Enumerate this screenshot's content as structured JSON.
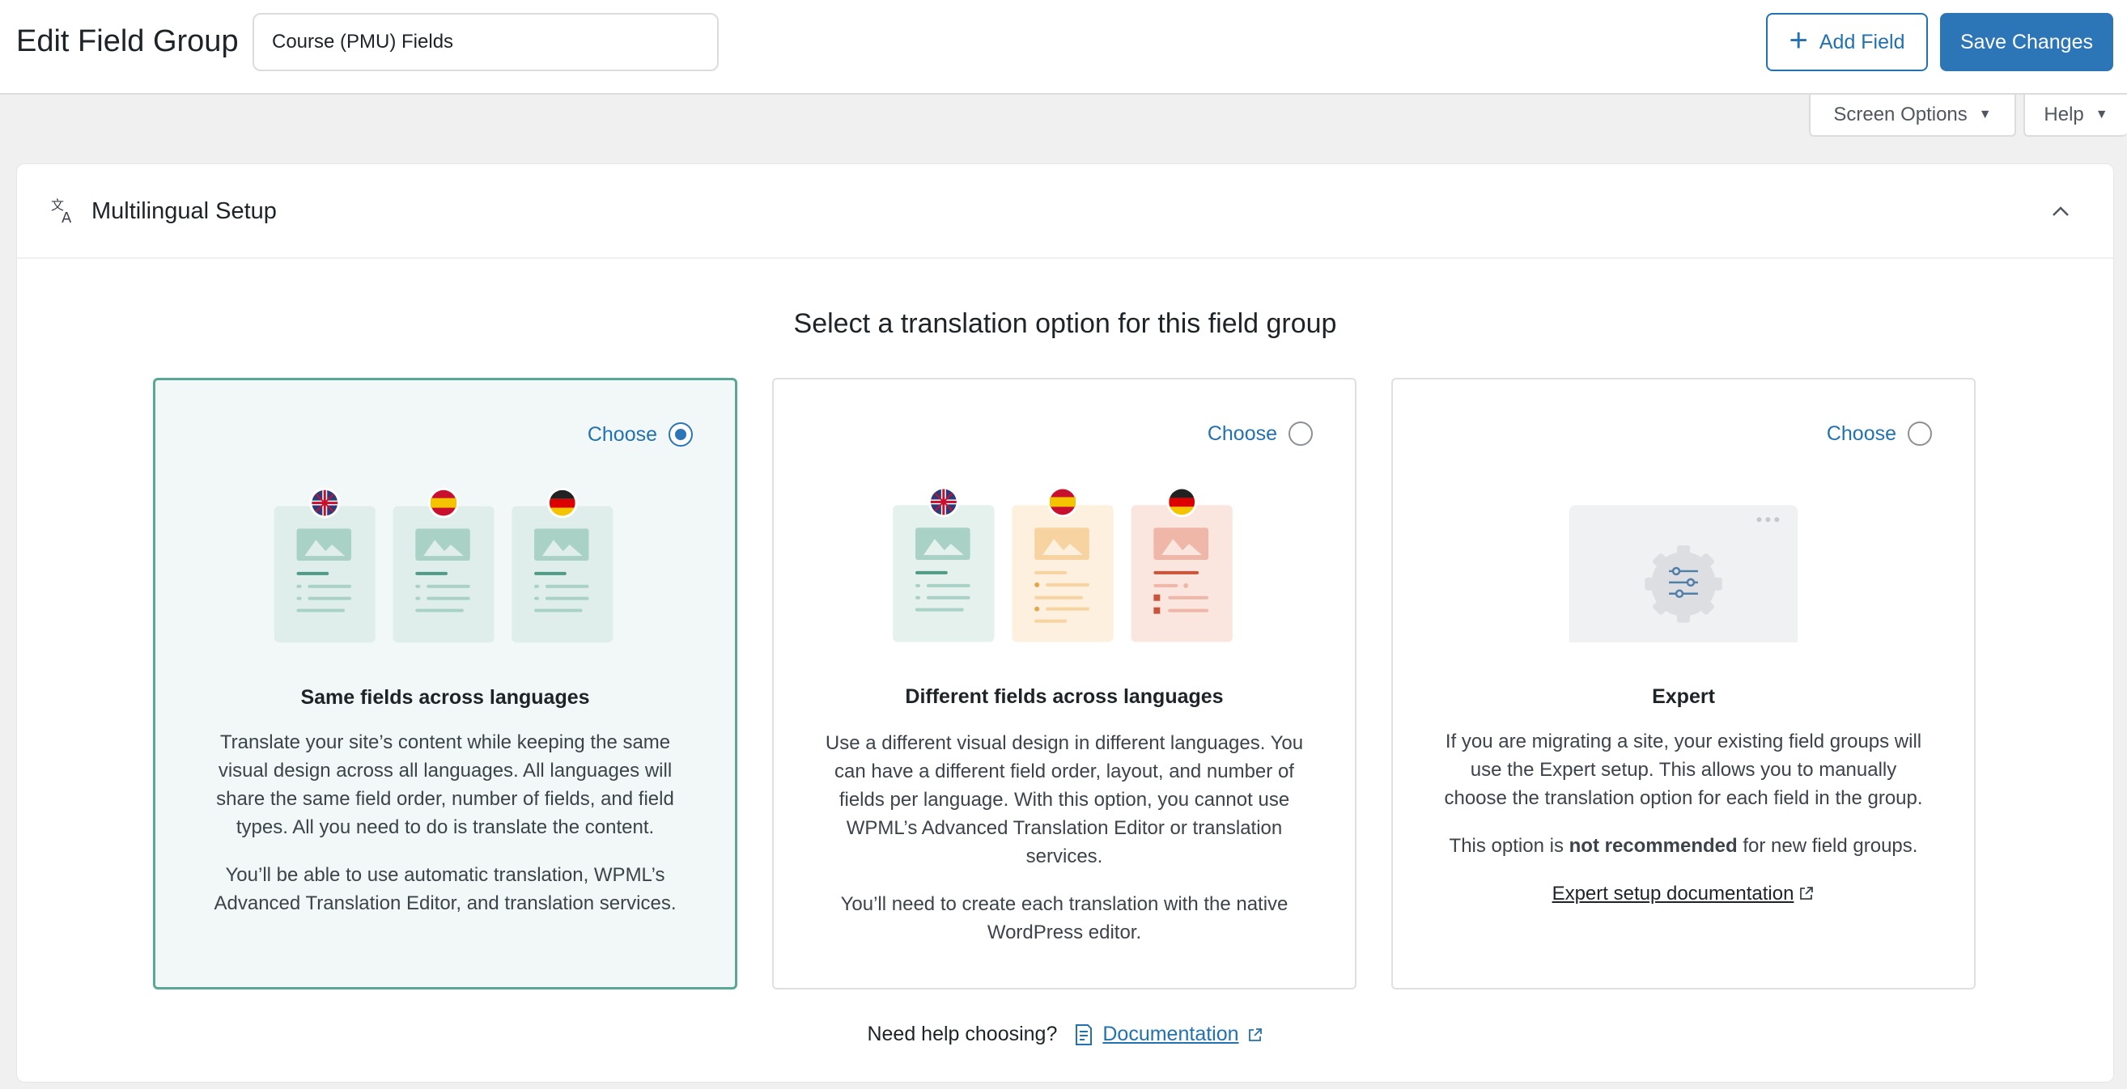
{
  "header": {
    "title": "Edit Field Group",
    "group_name": "Course (PMU) Fields",
    "add_field_label": "Add Field",
    "save_label": "Save Changes"
  },
  "screen_tabs": {
    "screen_options": "Screen Options",
    "help": "Help"
  },
  "panel": {
    "title": "Multilingual Setup",
    "heading": "Select a translation option for this field group",
    "options": [
      {
        "choose_label": "Choose",
        "selected": true,
        "name": "Same fields across languages",
        "desc1": "Translate your site’s content while keeping the same visual design across all languages. All languages will share the same field order, number of fields, and field types. All you need to do is translate the content.",
        "desc2": "You’ll be able to use automatic translation, WPML’s Advanced Translation Editor, and translation services."
      },
      {
        "choose_label": "Choose",
        "selected": false,
        "name": "Different fields across languages",
        "desc1": "Use a different visual design in different languages. You can have a different field order, layout, and number of fields per language. With this option, you cannot use WPML’s Advanced Translation Editor or translation services.",
        "desc2": "You’ll need to create each translation with the native WordPress editor."
      },
      {
        "choose_label": "Choose",
        "selected": false,
        "name": "Expert",
        "desc1": "If you are migrating a site, your existing field groups will use the Expert setup. This allows you to manually choose the translation option for each field in the group.",
        "desc2_pre": "This option is ",
        "desc2_bold": "not recommended",
        "desc2_post": " for new field groups.",
        "link": "Expert setup documentation"
      }
    ],
    "help_text": "Need help choosing?",
    "doc_link": "Documentation"
  },
  "colors": {
    "accent": "#2271b1",
    "save_button": "#2c75b6",
    "selected_border": "#58a895",
    "selected_bg": "#f1f8f7"
  }
}
